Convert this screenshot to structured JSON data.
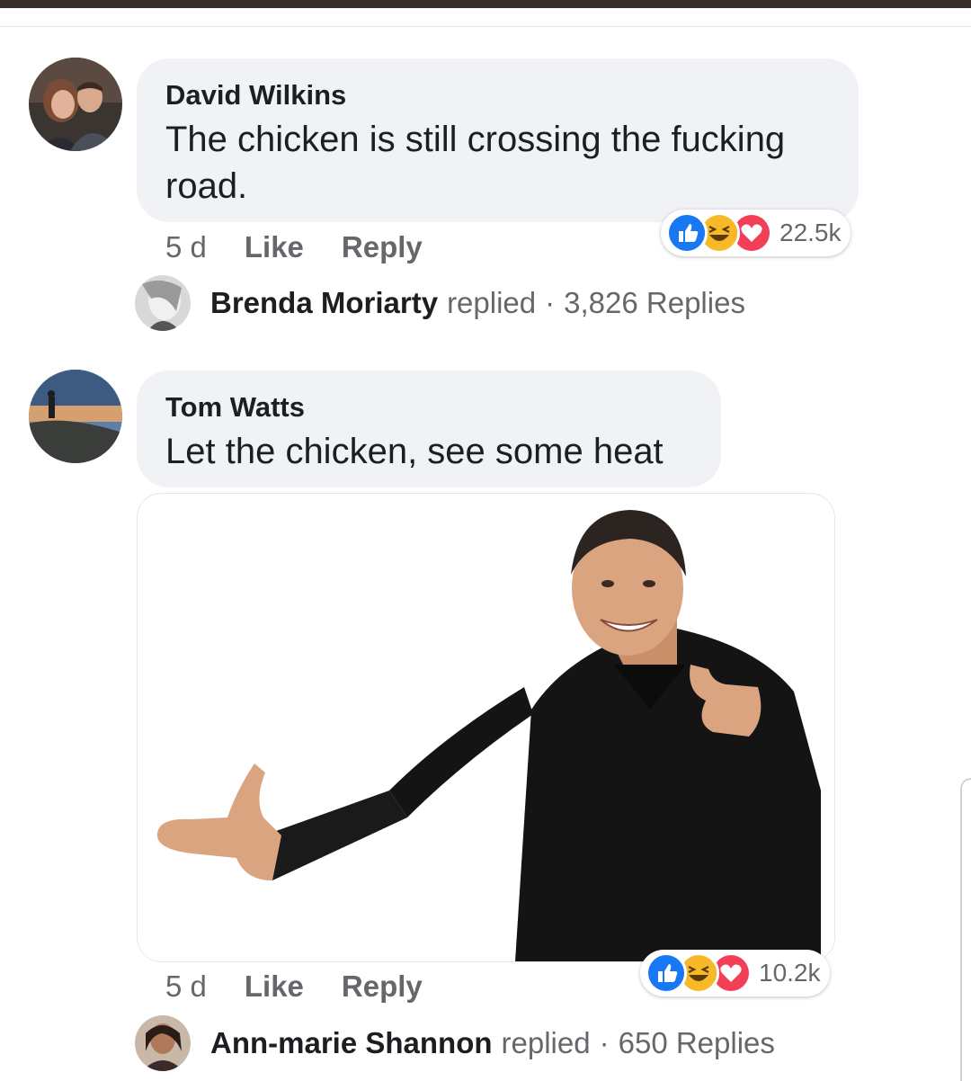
{
  "comments": [
    {
      "author": "David Wilkins",
      "text": "The chicken is still crossing the fucking road.",
      "time": "5 d",
      "like_label": "Like",
      "reply_label": "Reply",
      "reaction_count": "22.5k",
      "reactions": [
        "like-icon",
        "haha-icon",
        "love-icon"
      ],
      "reply_preview": {
        "name": "Brenda Moriarty",
        "verb": "replied",
        "separator": "·",
        "count": "3,826 Replies"
      }
    },
    {
      "author": "Tom Watts",
      "text": "Let the chicken, see some heat",
      "attachment": "photo of man pointing",
      "time": "5 d",
      "like_label": "Like",
      "reply_label": "Reply",
      "reaction_count": "10.2k",
      "reactions": [
        "like-icon",
        "haha-icon",
        "love-icon"
      ],
      "reply_preview": {
        "name": "Ann-marie Shannon",
        "verb": "replied",
        "separator": "·",
        "count": "650 Replies"
      }
    }
  ],
  "colors": {
    "bubble": "#f0f2f5",
    "like": "#1877f2",
    "haha": "#f7b928",
    "love": "#f33e58",
    "meta": "#65676b"
  }
}
